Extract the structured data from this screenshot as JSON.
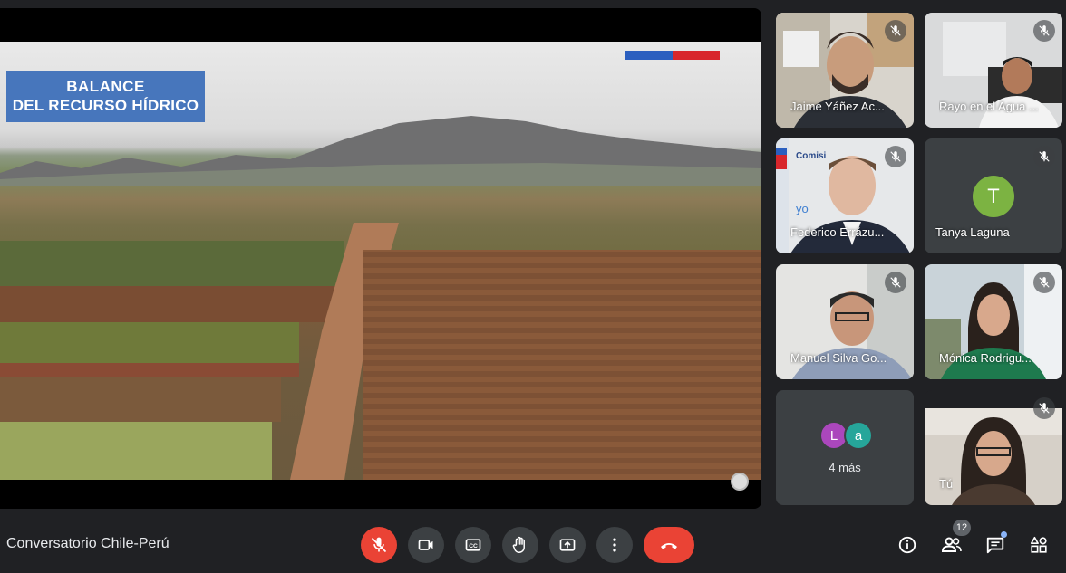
{
  "presentation": {
    "title_line1": "BALANCE",
    "title_line2": "DEL RECURSO HÍDRICO"
  },
  "participants": [
    {
      "name": "Jaime Yáñez Ac...",
      "muted": true
    },
    {
      "name": "Rayo en el Agua ...",
      "muted": true
    },
    {
      "name": "Federico Errázu...",
      "muted": true,
      "sign_text": "Comisi",
      "sign_text2": "yo"
    },
    {
      "name": "Tanya Laguna",
      "muted": true,
      "initial": "T",
      "avatar_color": "#7cb342"
    },
    {
      "name": "Manuel Silva Go...",
      "muted": true
    },
    {
      "name": "Mónica Rodrigu...",
      "muted": true
    },
    {
      "name": "Tú",
      "muted": true
    }
  ],
  "more_tile": {
    "label": "4 más",
    "avatars": [
      {
        "initial": "L",
        "color": "#ab47bc"
      },
      {
        "initial": "a",
        "color": "#26a69a"
      }
    ]
  },
  "meeting": {
    "title": "Conversatorio Chile-Perú",
    "people_count": "12"
  },
  "controls": {
    "mic": "mic-off-icon",
    "camera": "camera-icon",
    "captions": "captions-icon",
    "hand": "raise-hand-icon",
    "present": "present-screen-icon",
    "more": "more-options-icon",
    "end": "end-call-icon"
  },
  "colors": {
    "background": "#202124",
    "tile": "#3c4043",
    "end_call": "#ea4335",
    "accent": "#8ab4f8"
  }
}
